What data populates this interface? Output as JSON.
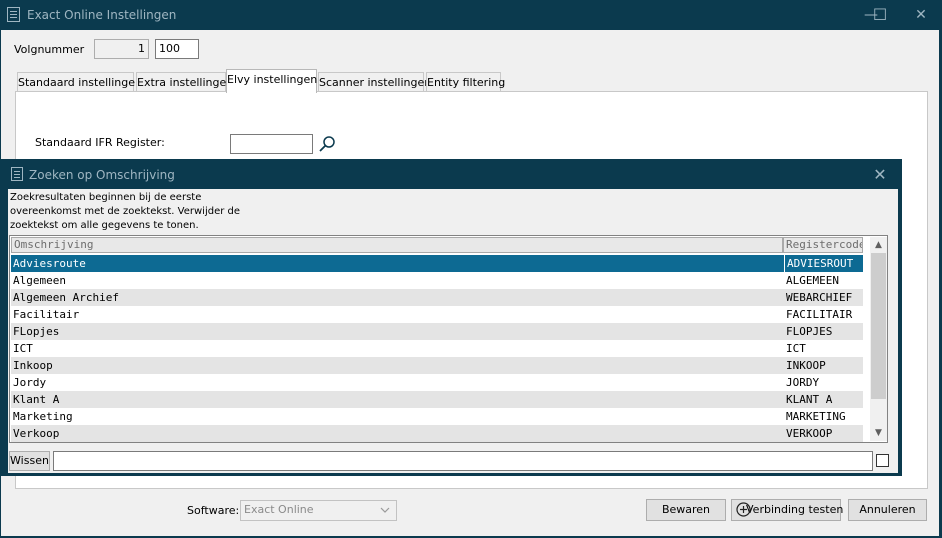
{
  "window": {
    "title": "Exact Online Instellingen",
    "minimize_label": "—",
    "maximize_label": "☐",
    "close_label": "✕"
  },
  "form": {
    "volgnummer_label": "Volgnummer",
    "volgnummer_from": "1",
    "volgnummer_to": "100"
  },
  "tabs": [
    {
      "label": "Standaard instellingen",
      "active": false
    },
    {
      "label": "Extra instellingen",
      "active": false
    },
    {
      "label": "Elvy instellingen",
      "active": true
    },
    {
      "label": "Scanner instellingen",
      "active": false
    },
    {
      "label": "Entity filtering",
      "active": false
    }
  ],
  "elvy": {
    "ifr_register_label": "Standaard IFR Register:",
    "ifr_register_value": ""
  },
  "footer": {
    "software_label": "Software:",
    "software_value": "Exact Online",
    "save_label": "Bewaren",
    "test_label": "Verbinding testen",
    "cancel_label": "Annuleren"
  },
  "dialog": {
    "title": "Zoeken op Omschrijving",
    "close_label": "✕",
    "hint": "Zoekresultaten beginnen bij de eerste overeenkomst met de zoektekst. Verwijder de zoektekst om alle gegevens te tonen.",
    "columns": [
      "Omschrijving",
      "Registercode"
    ],
    "rows": [
      {
        "omschrijving": "Adviesroute",
        "code": "ADVIESROUT",
        "selected": true
      },
      {
        "omschrijving": "Algemeen",
        "code": "ALGEMEEN",
        "selected": false
      },
      {
        "omschrijving": "Algemeen Archief",
        "code": "WEBARCHIEF",
        "selected": false
      },
      {
        "omschrijving": "Facilitair",
        "code": "FACILITAIR",
        "selected": false
      },
      {
        "omschrijving": "FLopjes",
        "code": "FLOPJES",
        "selected": false
      },
      {
        "omschrijving": "ICT",
        "code": "ICT",
        "selected": false
      },
      {
        "omschrijving": "Inkoop",
        "code": "INKOOP",
        "selected": false
      },
      {
        "omschrijving": "Jordy",
        "code": "JORDY",
        "selected": false
      },
      {
        "omschrijving": "Klant A",
        "code": "KLANT A",
        "selected": false
      },
      {
        "omschrijving": "Marketing",
        "code": "MARKETING",
        "selected": false
      },
      {
        "omschrijving": "Verkoop",
        "code": "VERKOOP",
        "selected": false
      }
    ],
    "clear_label": "Wissen",
    "search_value": ""
  },
  "colors": {
    "titlebar": "#0b3a4e",
    "selection": "#0d6a93",
    "alt_row": "#e4e4e4"
  }
}
